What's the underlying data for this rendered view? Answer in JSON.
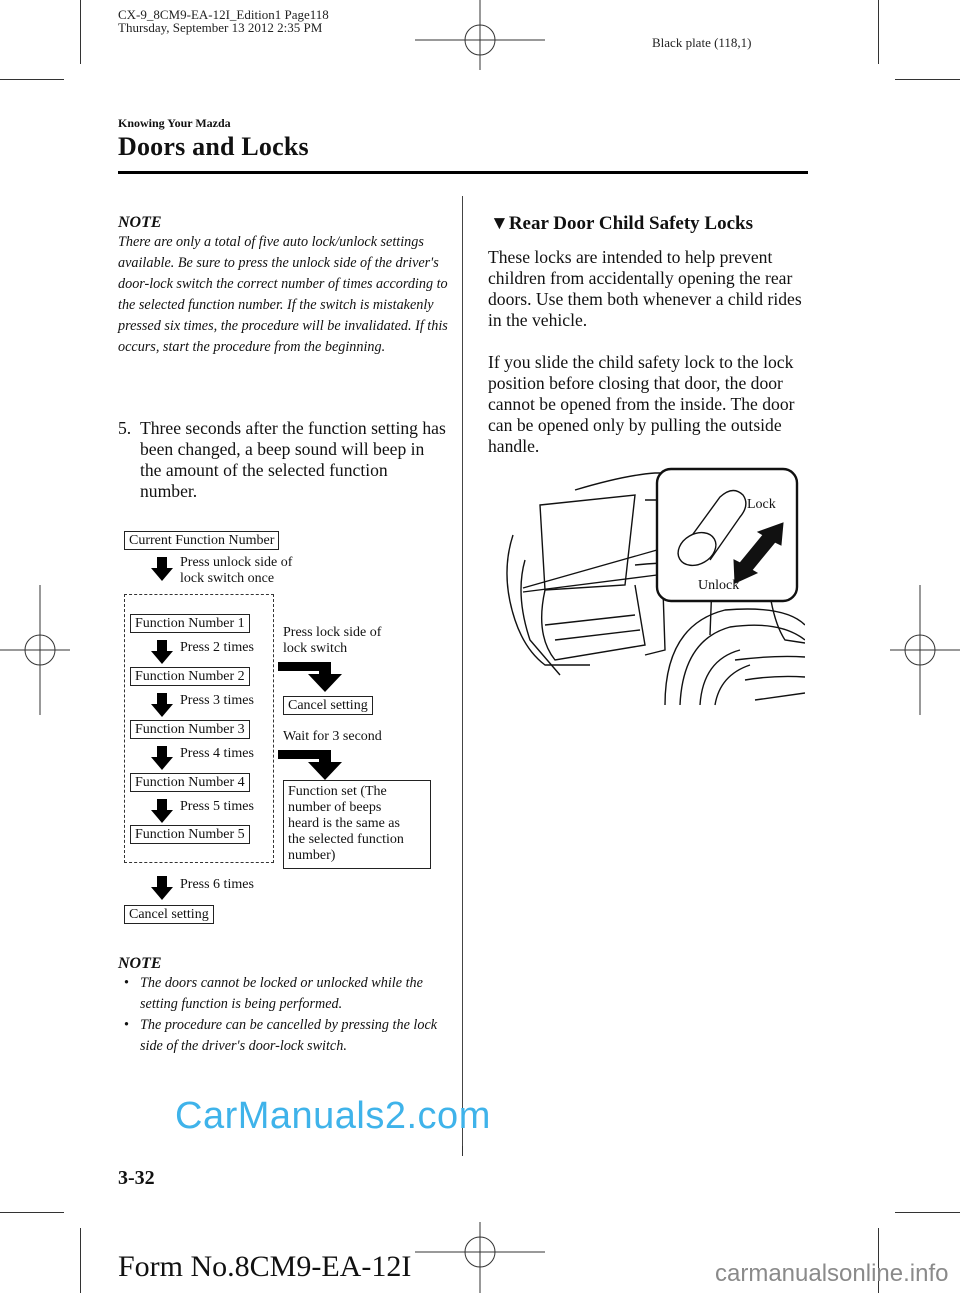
{
  "print_header": {
    "file_line": "CX-9_8CM9-EA-12I_Edition1 Page118",
    "date_line": "Thursday, September 13 2012 2:35 PM",
    "plate": "Black plate (118,1)"
  },
  "section": {
    "category": "Knowing Your Mazda",
    "title": "Doors and Locks"
  },
  "left_column": {
    "note1": {
      "heading": "NOTE",
      "text": "There are only a total of five auto lock/unlock settings available. Be sure to press the unlock side of the driver's door-lock switch the correct number of times according to the selected function number. If the switch is mistakenly pressed six times, the procedure will be invalidated. If this occurs, start the procedure from the beginning."
    },
    "step5": {
      "number": "5.",
      "text": "Three seconds after the function setting has been changed, a beep sound will beep in the amount of the selected function number."
    },
    "flow": {
      "start_box": "Current Function Number",
      "start_arrow_label_1": "Press unlock side of",
      "start_arrow_label_2": "lock switch once",
      "functions": [
        {
          "box": "Function Number 1",
          "arrow": "Press 2 times"
        },
        {
          "box": "Function Number 2",
          "arrow": "Press 3 times"
        },
        {
          "box": "Function Number 3",
          "arrow": "Press 4 times"
        },
        {
          "box": "Function Number 4",
          "arrow": "Press 5 times"
        },
        {
          "box": "Function Number 5",
          "arrow": ""
        }
      ],
      "press6_label": "Press 6 times",
      "cancel_bottom": "Cancel setting",
      "lock_side_label_1": "Press lock side of",
      "lock_side_label_2": "lock switch",
      "cancel_right": "Cancel setting",
      "wait_label": "Wait for 3 second",
      "function_set_lines": [
        "Function set (The",
        "number of beeps",
        "heard is the same as",
        "the selected function",
        "number)"
      ]
    },
    "note2": {
      "heading": "NOTE",
      "bullets": [
        "The doors cannot be locked or unlocked while the setting function is being performed.",
        "The procedure can be cancelled by pressing the lock side of the driver's door-lock switch."
      ]
    }
  },
  "right_column": {
    "heading_marker": "▼",
    "heading": "Rear Door Child Safety Locks",
    "para1": "These locks are intended to help prevent children from accidentally opening the rear doors. Use them both whenever a child rides in the vehicle.",
    "para2": "If you slide the child safety lock to the lock position before closing that door, the door cannot be opened from the inside. The door can be opened only by pulling the outside handle.",
    "illustration": {
      "lock_label": "Lock",
      "unlock_label": "Unlock"
    }
  },
  "footer": {
    "page_number": "3-32",
    "form_number": "Form No.8CM9-EA-12I"
  },
  "watermarks": {
    "center": "CarManuals2.com",
    "corner": "carmanualsonline.info",
    "center_color": "#3fb3ea"
  }
}
